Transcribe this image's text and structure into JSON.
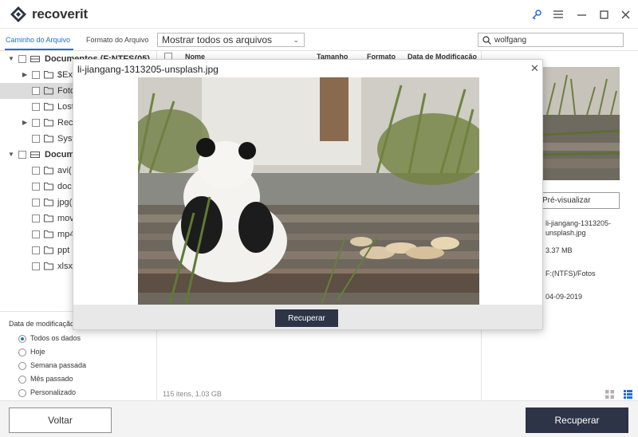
{
  "app": {
    "name": "recoverit"
  },
  "toolbar": {
    "tabs": [
      "Caminho do Arquivo",
      "Formato do Arquivo"
    ],
    "filter_value": "Mostrar todos os arquivos",
    "search_value": "wolfgang"
  },
  "tree": [
    {
      "label": "Documentos (F:NTFS(05)",
      "bold": true
    },
    {
      "label": "$Ex"
    },
    {
      "label": "Foto"
    },
    {
      "label": "Lost"
    },
    {
      "label": "Recy"
    },
    {
      "label": "Syst"
    },
    {
      "label": "Docum",
      "bold": true
    },
    {
      "label": "avi("
    },
    {
      "label": "doc"
    },
    {
      "label": "jpg("
    },
    {
      "label": "mov"
    },
    {
      "label": "mp4"
    },
    {
      "label": "ppt"
    },
    {
      "label": "xlsx"
    }
  ],
  "date_filter": {
    "title": "Data de modificação",
    "options": [
      "Todos os dados",
      "Hoje",
      "Semana passada",
      "Mês passado",
      "Personalizado"
    ],
    "selected_index": 0
  },
  "table": {
    "columns": [
      "Nome",
      "Tamanho",
      "Formato",
      "Data de Modificação"
    ]
  },
  "preview": {
    "button_label": "Pré-visualizar",
    "file_name": "li-jiangang-1313205-unsplash.jpg",
    "file_name_line1": "li-jiangang-1313205-",
    "file_name_line2": "unsplash.jpg",
    "size": "3.37  MB",
    "path": "F:(NTFS)/Fotos",
    "date": "04-09-2019"
  },
  "status": {
    "text": "115 itens, 1.03  GB"
  },
  "bottom": {
    "back_label": "Voltar",
    "recover_label": "Recuperar"
  },
  "modal": {
    "title": "li-jiangang-1313205-unsplash.jpg",
    "recover_label": "Recuperar"
  },
  "colors": {
    "accent": "#1e6fd9",
    "dark_button": "#2c3446"
  }
}
